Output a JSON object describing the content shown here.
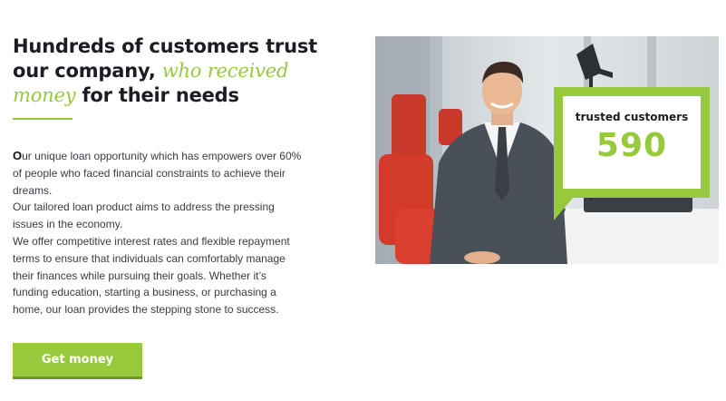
{
  "heading": {
    "line1": "Hundreds of customers trust",
    "line2_prefix": "our company, ",
    "accent1": "who received",
    "accent2": "money",
    "line3_suffix": " for their needs"
  },
  "body": {
    "dropcap": "O",
    "para1_rest": "ur unique loan opportunity which has empowers over 60% of people who faced financial constraints to achieve their dreams.",
    "para2": "Our tailored loan product aims to address the pressing issues in the economy.",
    "para3": "We offer competitive interest rates and flexible repayment terms to ensure that individuals can comfortably manage their finances while pursuing their goals. Whether it’s funding education, starting a business, or purchasing a home, our loan provides the stepping stone to success."
  },
  "cta": {
    "label": "Get money"
  },
  "stat": {
    "label": "trusted customers",
    "value": "590"
  },
  "colors": {
    "accent": "#97c93d",
    "heading": "#1c1c24",
    "body": "#3b3b45"
  },
  "photo": {
    "icon": "businessman-at-desk-photo"
  }
}
